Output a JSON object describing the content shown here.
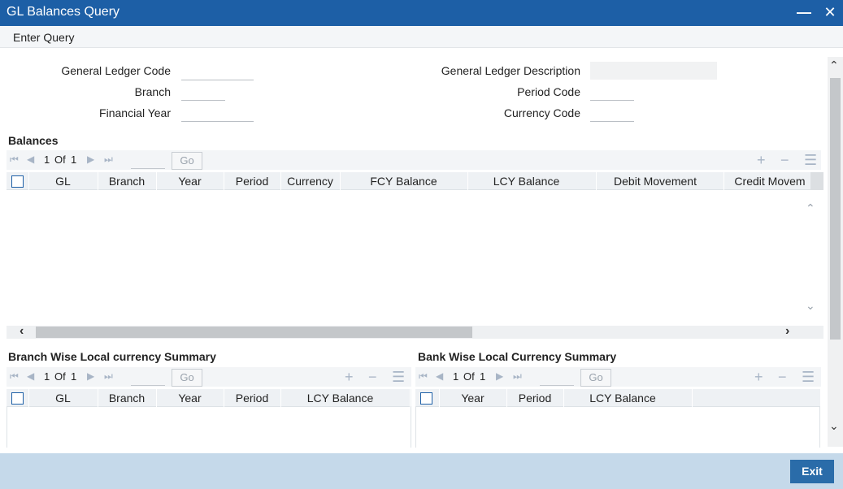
{
  "window": {
    "title": "GL Balances Query",
    "minimize_icon": "minimize-icon",
    "close_icon": "close-icon"
  },
  "menu": {
    "enter_query": "Enter Query"
  },
  "form": {
    "gl_code_label": "General Ledger Code",
    "gl_code_value": "",
    "branch_label": "Branch",
    "branch_value": "",
    "fin_year_label": "Financial Year",
    "fin_year_value": "",
    "gl_desc_label": "General Ledger Description",
    "gl_desc_value": "",
    "period_code_label": "Period Code",
    "period_code_value": "",
    "currency_code_label": "Currency Code",
    "currency_code_value": ""
  },
  "balances": {
    "title": "Balances",
    "pager": {
      "current": "1",
      "of_label": "Of",
      "total": "1",
      "go_label": "Go"
    },
    "columns": [
      "GL",
      "Branch",
      "Year",
      "Period",
      "Currency",
      "FCY Balance",
      "LCY Balance",
      "Debit Movement",
      "Credit Movem"
    ],
    "rows": []
  },
  "branch_summary": {
    "title": "Branch Wise Local currency Summary",
    "pager": {
      "current": "1",
      "of_label": "Of",
      "total": "1",
      "go_label": "Go"
    },
    "columns": [
      "GL",
      "Branch",
      "Year",
      "Period",
      "LCY Balance"
    ],
    "rows": []
  },
  "bank_summary": {
    "title": "Bank Wise Local Currency Summary",
    "pager": {
      "current": "1",
      "of_label": "Of",
      "total": "1",
      "go_label": "Go"
    },
    "columns": [
      "Year",
      "Period",
      "LCY Balance"
    ],
    "rows": []
  },
  "footer": {
    "exit_label": "Exit"
  },
  "colors": {
    "titlebar": "#1d5fa6",
    "footer": "#c5d9ea",
    "exit_button": "#2a6ca9",
    "grid_header": "#eef1f4"
  }
}
